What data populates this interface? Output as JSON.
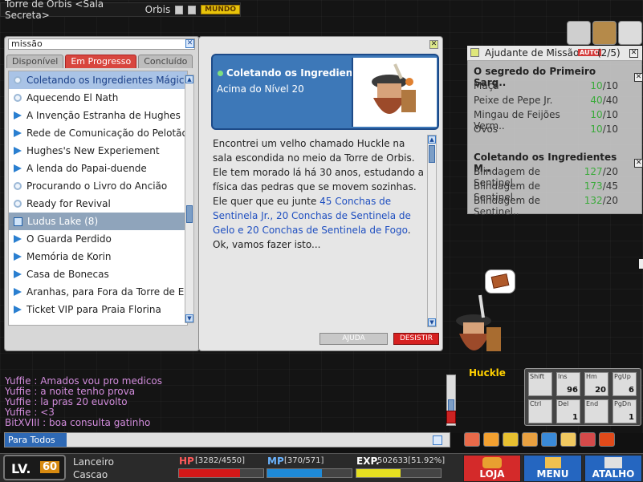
{
  "location": {
    "title": "Torre de Orbis <Sala Secreta>",
    "world": "Orbis",
    "mundo_label": "MUNDO"
  },
  "quest_window": {
    "search_value": "missão",
    "tabs": [
      {
        "label": "Disponível"
      },
      {
        "label": "Em Progresso"
      },
      {
        "label": "Concluído"
      }
    ],
    "items": [
      {
        "label": "Coletando os Ingredientes Mágic..",
        "icon": "circle"
      },
      {
        "label": "Aquecendo El Nath",
        "icon": "circle"
      },
      {
        "label": "A Invenção Estranha de Hughes",
        "icon": "arrow"
      },
      {
        "label": "Rede de Comunicação do Pelotão A",
        "icon": "arrow"
      },
      {
        "label": "Hughes's New Experiement",
        "icon": "arrow"
      },
      {
        "label": "A lenda do Papai-duende",
        "icon": "arrow"
      },
      {
        "label": "Procurando o Livro do Ancião",
        "icon": "circle"
      },
      {
        "label": "Ready for Revival",
        "icon": "circle"
      },
      {
        "label": "Ludus Lake (8)",
        "icon": "box"
      },
      {
        "label": "O Guarda Perdido",
        "icon": "arrow"
      },
      {
        "label": "Memória de Korin",
        "icon": "arrow"
      },
      {
        "label": "Casa de Bonecas",
        "icon": "arrow"
      },
      {
        "label": "Aranhas, para Fora da Torre de Eos",
        "icon": "arrow"
      },
      {
        "label": "Ticket VIP para Praia Florina",
        "icon": "arrow"
      }
    ]
  },
  "detail": {
    "title": "Coletando os Ingrediente..",
    "subtitle": "Acima do Nível 20",
    "text_before": "Encontrei um velho chamado Huckle na sala escondida no meio da Torre de Orbis. Ele tem morado lá há 30 anos, estudando a física das pedras que se movem sozinhas. Ele quer que eu junte ",
    "text_link": "45 Conchas de Sentinela Jr., 20 Conchas de Sentinela de Gelo e 20 Conchas de Sentinela de Fogo",
    "text_after": ". Ok, vamos fazer isto...",
    "ajuda_label": "AJUDA",
    "desistir_label": "DESISTIR"
  },
  "helper": {
    "title": "Ajudante de Missão",
    "auto_label": "AUTO",
    "count": "(2/5)",
    "quests": [
      {
        "name": "O segredo do Primeiro Sarg..",
        "rows": [
          {
            "item": "Maçã",
            "have": "10",
            "need": "/10"
          },
          {
            "item": "Peixe de Pepe Jr.",
            "have": "40",
            "need": "/40"
          },
          {
            "item": "Mingau de Feijões Verm..",
            "have": "10",
            "need": "/10"
          },
          {
            "item": "Ovos",
            "have": "10",
            "need": "/10"
          }
        ]
      },
      {
        "name": "Coletando os Ingredientes M..",
        "rows": [
          {
            "item": "Blindagem de Sentinel..",
            "have": "127",
            "need": "/20"
          },
          {
            "item": "Blindagem de Sentinel..",
            "have": "173",
            "need": "/45"
          },
          {
            "item": "Blindagem de Sentinel..",
            "have": "132",
            "need": "/20"
          }
        ]
      }
    ]
  },
  "npc_name": "Huckle",
  "chat": {
    "lines": [
      "Yuffie : Amados vou pro medicos",
      "Yuffie : a noite tenho prova",
      "Yuffie : la pras 20 euvolto",
      "Yuffie : <3",
      "BitXVIII : boa consulta gatinho"
    ],
    "channel_label": "Para Todos"
  },
  "skills": {
    "row1": [
      "Shift",
      "Ins",
      "Hm",
      "PgUp"
    ],
    "row2": [
      "Ctrl",
      "Del",
      "End",
      "PgDn"
    ],
    "counts": [
      "",
      "96",
      "20",
      "6"
    ],
    "counts2": [
      "",
      "1",
      "",
      "1"
    ]
  },
  "status": {
    "lv_label": "LV.",
    "level": "60",
    "job": "Lanceiro",
    "name": "Cascao",
    "hp_label": "HP",
    "hp_text": "[3282/4550]",
    "hp_frac": 0.721,
    "mp_label": "MP",
    "mp_text": "[370/571]",
    "mp_frac": 0.648,
    "exp_label": "EXP.",
    "exp_text": "502633[51.92%]",
    "exp_frac": 0.5192,
    "buttons": {
      "loja": "LOJA",
      "menu": "MENU",
      "atalho": "ATALHO"
    }
  },
  "colors": {
    "hp": "#d31818",
    "mp": "#1e8ad8",
    "exp": "#e6e020",
    "loja": "#d42a2a",
    "menu": "#2566c0",
    "atalho": "#2566c0"
  }
}
